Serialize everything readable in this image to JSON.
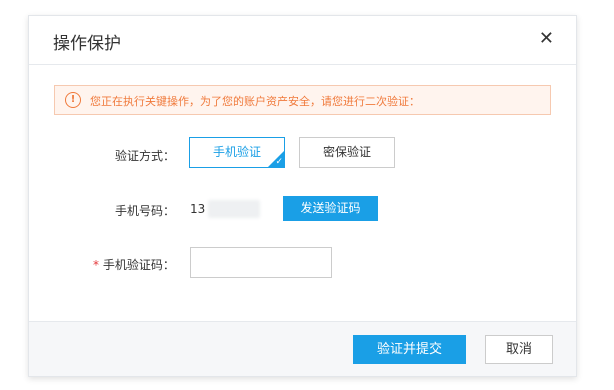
{
  "dialog": {
    "title": "操作保护",
    "close_icon": "close-icon"
  },
  "alert": {
    "icon": "warning-circle-icon",
    "icon_glyph": "!",
    "text": "您正在执行关键操作，为了您的账户资产安全，请您进行二次验证：",
    "color": "#f07a3c"
  },
  "verify_method": {
    "label": "验证方式：",
    "options": [
      "手机验证",
      "密保验证"
    ],
    "selected": "手机验证",
    "accent": "#1a9fe6"
  },
  "phone": {
    "label": "手机号码：",
    "value_visible": "13",
    "send_button": "发送验证码"
  },
  "code": {
    "required_mark": "*",
    "label": "手机验证码：",
    "value": "",
    "placeholder": ""
  },
  "footer": {
    "submit": "验证并提交",
    "cancel": "取消"
  }
}
